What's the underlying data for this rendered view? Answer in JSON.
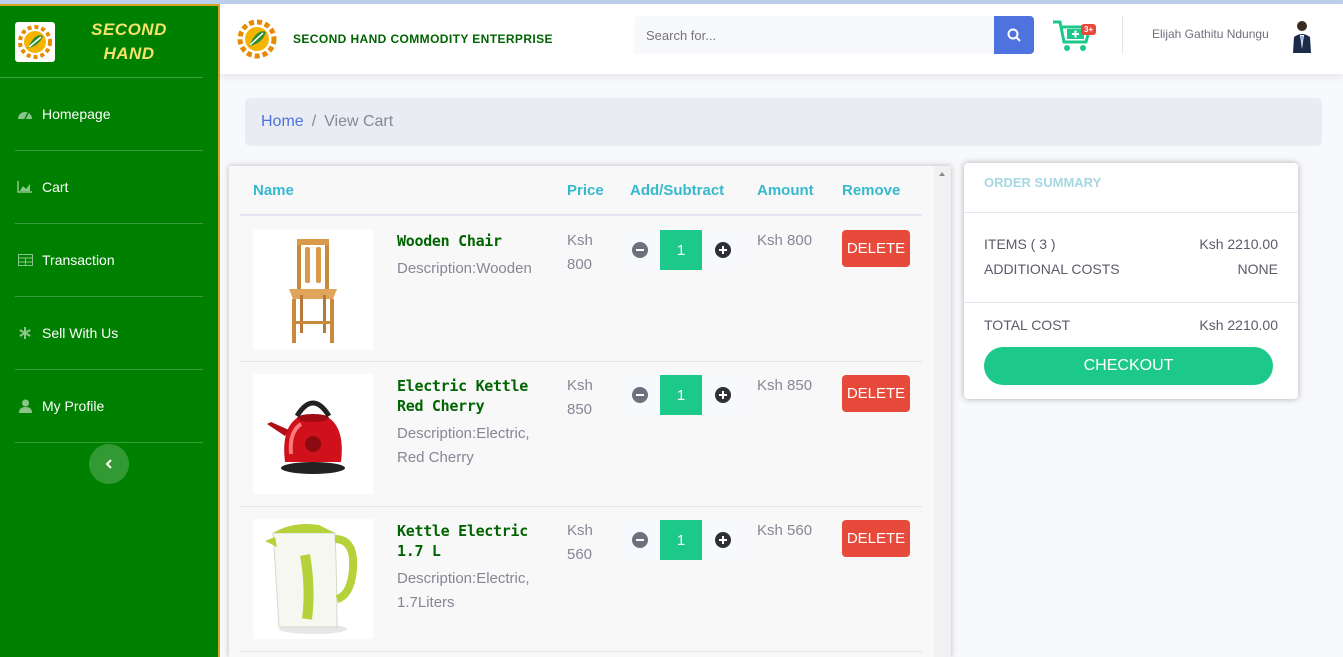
{
  "brand": {
    "name_line1": "SECOND",
    "name_line2": "HAND"
  },
  "sidebar": {
    "items": [
      {
        "label": "Homepage",
        "icon": "dashboard-icon"
      },
      {
        "label": "Cart",
        "icon": "chart-area-icon"
      },
      {
        "label": "Transaction",
        "icon": "table-icon"
      },
      {
        "label": "Sell With Us",
        "icon": "asterisk-icon"
      },
      {
        "label": "My Profile",
        "icon": "user-icon"
      }
    ],
    "toggle_icon": "chevron-left-icon"
  },
  "topbar": {
    "title": "SECOND HAND COMMODITY ENTERPRISE",
    "search_placeholder": "Search for...",
    "cart_badge": "3+",
    "user_name": "Elijah Gathitu Ndungu"
  },
  "breadcrumb": {
    "home": "Home",
    "separator": "/",
    "current": "View Cart"
  },
  "cart": {
    "headers": {
      "name": "Name",
      "price": "Price",
      "add_subtract": "Add/Subtract",
      "amount": "Amount",
      "remove": "Remove"
    },
    "items": [
      {
        "name": "Wooden Chair",
        "description": "Description:Wooden",
        "price_currency": "Ksh",
        "price_value": "800",
        "quantity": "1",
        "amount": "Ksh 800",
        "delete_label": "DELETE"
      },
      {
        "name": "Electric Kettle Red Cherry",
        "description": "Description:Electric, Red Cherry",
        "price_currency": "Ksh",
        "price_value": "850",
        "quantity": "1",
        "amount": "Ksh 850",
        "delete_label": "DELETE"
      },
      {
        "name": "Kettle Electric 1.7 L",
        "description": "Description:Electric, 1.7Liters",
        "price_currency": "Ksh",
        "price_value": "560",
        "quantity": "1",
        "amount": "Ksh 560",
        "delete_label": "DELETE"
      }
    ]
  },
  "summary": {
    "title": "ORDER SUMMARY",
    "items_label": "ITEMS ( 3 )",
    "items_value": "Ksh 2210.00",
    "additional_label": "ADDITIONAL COSTS",
    "additional_value": "NONE",
    "total_label": "TOTAL COST",
    "total_value": "Ksh 2210.00",
    "checkout_label": "CHECKOUT"
  },
  "colors": {
    "sidebar": "#008000",
    "accent_green": "#1cc88a",
    "primary_blue": "#4e73df",
    "danger_red": "#e74a3b",
    "header_teal": "#36b9cc"
  }
}
